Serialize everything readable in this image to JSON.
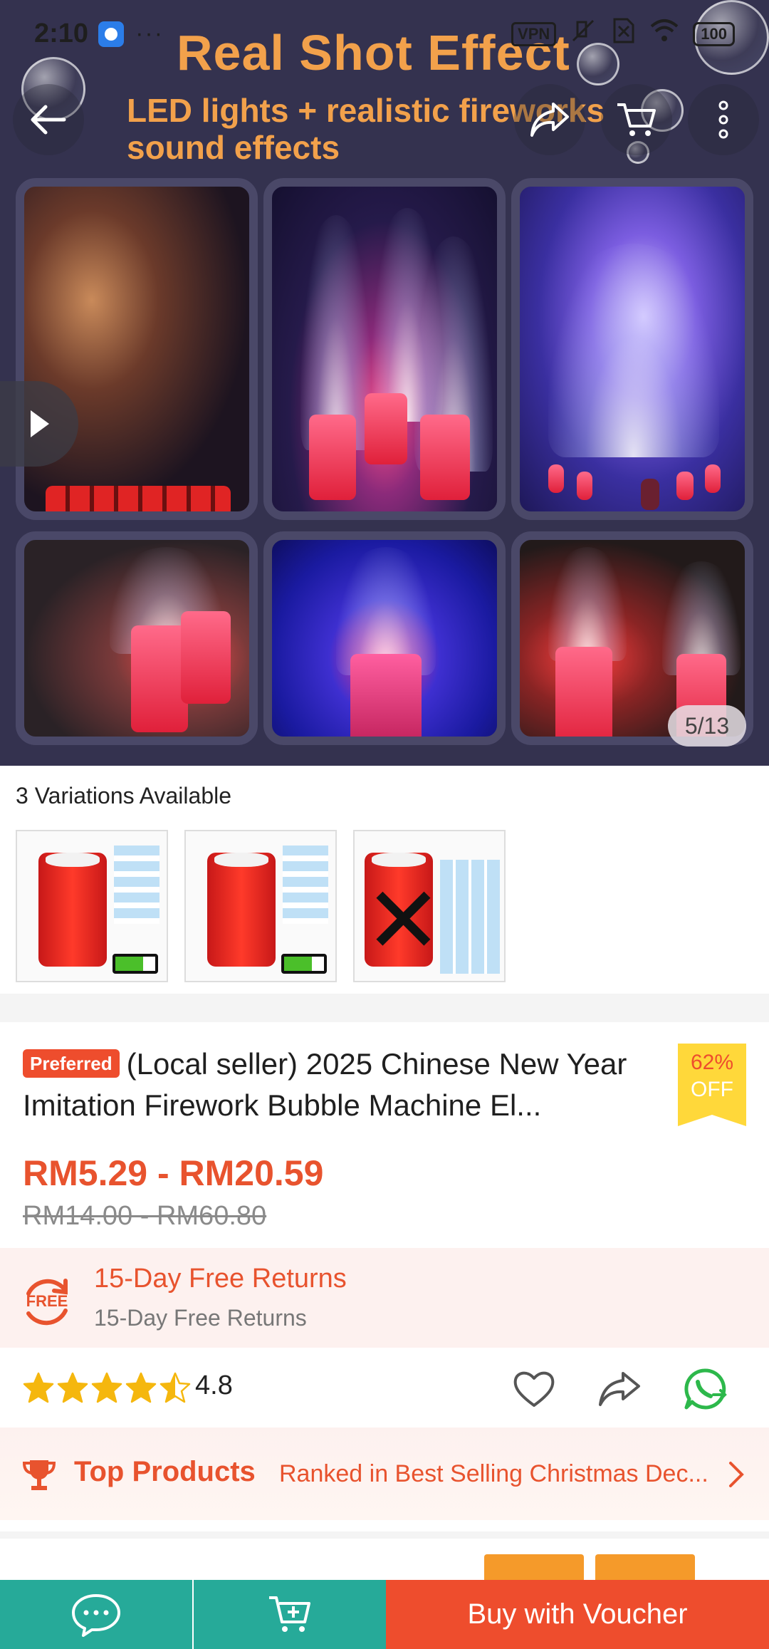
{
  "status_bar": {
    "time": "2:10",
    "more": "···",
    "vpn": "VPN",
    "battery": "100"
  },
  "hero": {
    "title": "Real Shot Effect",
    "subtitle_line1": "LED lights + realistic fireworks",
    "subtitle_line2": "sound effects",
    "image_counter": "5/13"
  },
  "variations": {
    "title": "3 Variations Available",
    "items": [
      {
        "name": "variation-1"
      },
      {
        "name": "variation-2"
      },
      {
        "name": "variation-3"
      }
    ]
  },
  "product": {
    "badge": "Preferred",
    "title": "(Local seller) 2025 Chinese New Year Imitation Firework Bubble Machine El...",
    "discount_percent": "62%",
    "discount_label": "OFF",
    "price": "RM5.29 - RM20.59",
    "original_price": "RM14.00 - RM60.80"
  },
  "returns": {
    "icon_text": "FREE",
    "title": "15-Day Free Returns",
    "subtitle": "15-Day Free Returns"
  },
  "rating": {
    "value": "4.8",
    "stars": 4.5
  },
  "top_products": {
    "label": "Top Products",
    "text": "Ranked in Best Selling Christmas Dec..."
  },
  "bottom_bar": {
    "buy_label": "Buy with Voucher"
  },
  "colors": {
    "brand": "#ee4d2d",
    "teal": "#26aa99",
    "hero_bg": "#34324f",
    "title_orange": "#f2a14b"
  }
}
